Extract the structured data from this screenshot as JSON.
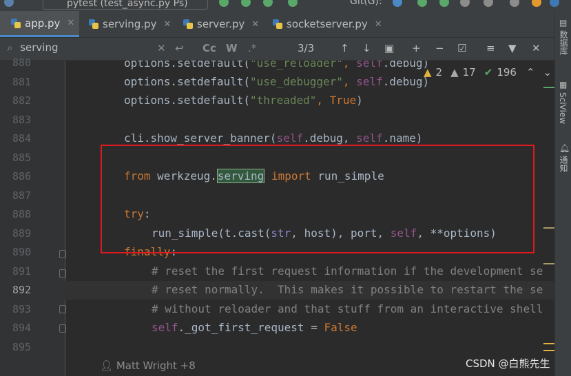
{
  "toolbar": {
    "run_config": "pytest (test_async.py Ps)",
    "vcs_label": "Git(G):"
  },
  "tabs": [
    {
      "label": "app.py",
      "active": true
    },
    {
      "label": "serving.py",
      "active": false
    },
    {
      "label": "server.py",
      "active": false
    },
    {
      "label": "socketserver.py",
      "active": false
    }
  ],
  "find": {
    "query": "serving",
    "match_count": "3/3",
    "cc_label": "Cc",
    "word_label": "W",
    "regex_label": ".*"
  },
  "inspections": {
    "warnings": "2",
    "weak_warnings": "17",
    "ok": "196"
  },
  "line_numbers": [
    "880",
    "881",
    "882",
    "883",
    "884",
    "885",
    "886",
    "887",
    "888",
    "889",
    "890",
    "891",
    "892",
    "893",
    "894",
    "895"
  ],
  "current_line": "892",
  "code": {
    "l880_a": "options.setdefault(",
    "l880_b": "\"use_reloader\"",
    "l880_c": ", ",
    "l880_d": "self",
    "l880_e": ".debug)",
    "l881_a": "options.setdefault(",
    "l881_b": "\"use_debugger\"",
    "l881_c": ", ",
    "l881_d": "self",
    "l881_e": ".debug)",
    "l882_a": "options.setdefault(",
    "l882_b": "\"threaded\"",
    "l882_c": ", ",
    "l882_d": "True",
    "l882_e": ")",
    "l884_a": "cli.show_server_banner(",
    "l884_b": "self",
    "l884_c": ".debug, ",
    "l884_d": "self",
    "l884_e": ".name)",
    "l886_a": "from ",
    "l886_b": "werkzeug.",
    "l886_c": "serving",
    "l886_d": " import ",
    "l886_e": "run_simple",
    "l888_a": "try",
    "l888_b": ":",
    "l889_a": "run_simple(t.cast(",
    "l889_b": "str",
    "l889_c": ", host), port, ",
    "l889_d": "self",
    "l889_e": ", **options)",
    "l890_a": "finally",
    "l890_b": ":",
    "l891": "# reset the first request information if the development se",
    "l892": "# reset normally.  This makes it possible to restart the se",
    "l893": "# without reloader and that stuff from an interactive shell",
    "l894_a": "self",
    "l894_b": "._got_first_request = ",
    "l894_c": "False"
  },
  "author": "Matt Wright +8",
  "side_labels": {
    "database": "数据库",
    "sciview": "SciView",
    "notifications": "通知"
  },
  "watermark": "CSDN @白熊先生",
  "colors": {
    "highlight_box": "#e0191f",
    "keyword": "#cc7832",
    "string": "#6a8759",
    "self": "#94558d",
    "comment": "#808080"
  }
}
